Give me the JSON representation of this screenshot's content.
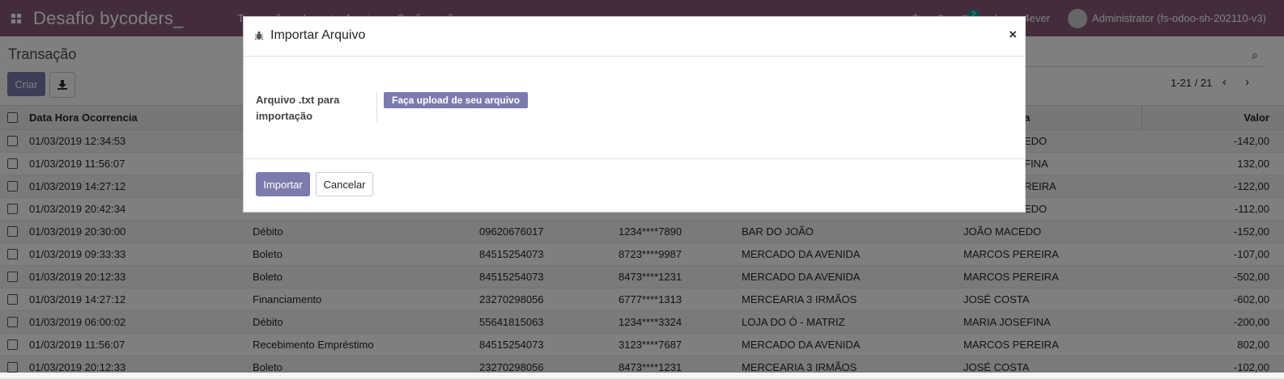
{
  "navbar": {
    "brand": "Desafio bycoders_",
    "menu": [
      "Transação",
      "Importar Arquivo",
      "Configuração"
    ],
    "chat_badge": "2",
    "company": "Image4ever",
    "user": "Administrator (fs-odoo-sh-202110-v3)",
    "color": "#875a7b"
  },
  "control_panel": {
    "breadcrumb": "Transação",
    "create_label": "Criar",
    "pager": "1-21 / 21"
  },
  "list": {
    "headers": {
      "data": "Data Hora Ocorrencia",
      "dono": "a",
      "valor": "Valor"
    },
    "rows": [
      {
        "data": "01/03/2019 12:34:53",
        "tipo": "",
        "cpf": "",
        "cartao": "",
        "loja": "",
        "dono": "EDO",
        "valor": "-142,00"
      },
      {
        "data": "01/03/2019 11:56:07",
        "tipo": "",
        "cpf": "",
        "cartao": "",
        "loja": "",
        "dono": "FINA",
        "valor": "132,00"
      },
      {
        "data": "01/03/2019 14:27:12",
        "tipo": "",
        "cpf": "",
        "cartao": "",
        "loja": "",
        "dono": "REIRA",
        "valor": "-122,00"
      },
      {
        "data": "01/03/2019 20:42:34",
        "tipo": "",
        "cpf": "",
        "cartao": "",
        "loja": "",
        "dono": "EDO",
        "valor": "-112,00"
      },
      {
        "data": "01/03/2019 20:30:00",
        "tipo": "Débito",
        "cpf": "09620676017",
        "cartao": "1234****7890",
        "loja": "BAR DO JOÃO",
        "dono": "JOÃO MACEDO",
        "valor": "-152,00"
      },
      {
        "data": "01/03/2019 09:33:33",
        "tipo": "Boleto",
        "cpf": "84515254073",
        "cartao": "8723****9987",
        "loja": "MERCADO DA AVENIDA",
        "dono": "MARCOS PEREIRA",
        "valor": "-107,00"
      },
      {
        "data": "01/03/2019 20:12:33",
        "tipo": "Boleto",
        "cpf": "84515254073",
        "cartao": "8473****1231",
        "loja": "MERCADO DA AVENIDA",
        "dono": "MARCOS PEREIRA",
        "valor": "-502,00"
      },
      {
        "data": "01/03/2019 14:27:12",
        "tipo": "Financiamento",
        "cpf": "23270298056",
        "cartao": "6777****1313",
        "loja": "MERCEARIA 3 IRMÃOS",
        "dono": "JOSÉ COSTA",
        "valor": "-602,00"
      },
      {
        "data": "01/03/2019 06:00:02",
        "tipo": "Débito",
        "cpf": "55641815063",
        "cartao": "1234****3324",
        "loja": "LOJA DO Ó - MATRIZ",
        "dono": "MARIA JOSEFINA",
        "valor": "-200,00"
      },
      {
        "data": "01/03/2019 11:56:07",
        "tipo": "Recebimento Empréstimo",
        "cpf": "84515254073",
        "cartao": "3123****7687",
        "loja": "MERCADO DA AVENIDA",
        "dono": "MARCOS PEREIRA",
        "valor": "802,00"
      },
      {
        "data": "01/03/2019 20:12:33",
        "tipo": "Boleto",
        "cpf": "23270298056",
        "cartao": "8473****1231",
        "loja": "MERCEARIA 3 IRMÃOS",
        "dono": "JOSÉ COSTA",
        "valor": "-102,00"
      }
    ]
  },
  "modal": {
    "title": "Importar Arquivo",
    "field_label": "Arquivo .txt para importação",
    "upload_label": "Faça upload de seu arquivo",
    "import_label": "Importar",
    "cancel_label": "Cancelar",
    "close_glyph": "×",
    "accent": "#7c7bad"
  }
}
